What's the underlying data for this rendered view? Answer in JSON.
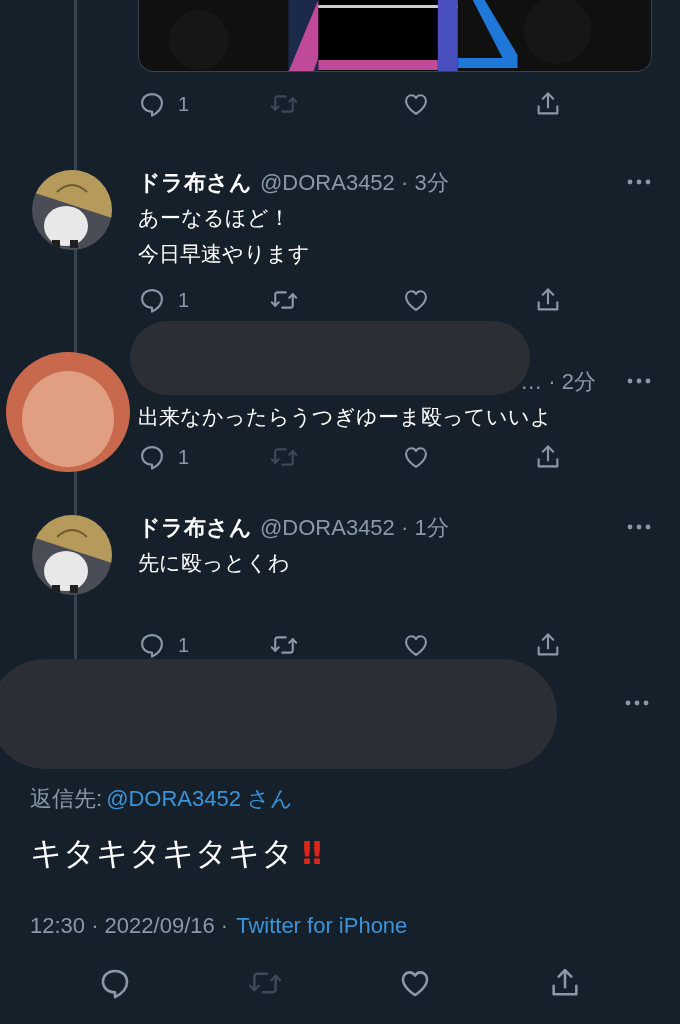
{
  "image_tweet": {
    "reply_count": "1",
    "retweet_disabled": true
  },
  "replies": [
    {
      "kind": "normal",
      "avatar": {
        "kind": "illustration"
      },
      "name": "ドラ布さん",
      "meta": "@DORA3452 · 3分",
      "lines": [
        "あーなるほど！",
        "今日早速やります"
      ],
      "reply_count": "1",
      "retweet_disabled": false
    },
    {
      "kind": "redacted",
      "avatar": {
        "kind": "monkey"
      },
      "meta": "… · 2分",
      "lines": [
        "出来なかったらうつぎゆーま殴っていいよ"
      ],
      "reply_count": "1",
      "retweet_disabled": true
    },
    {
      "kind": "normal",
      "avatar": {
        "kind": "illustration"
      },
      "name": "ドラ布さん",
      "meta": "@DORA3452 · 1分",
      "lines": [
        "先に殴っとくわ"
      ],
      "reply_count": "1",
      "retweet_disabled": false
    }
  ],
  "main_tweet": {
    "redacted": true,
    "reply_to_label": "返信先:",
    "reply_to": "@DORA3452 さん",
    "text": "キタキタキタキタ",
    "emphasis": "‼",
    "timestamp": "12:30 · 2022/09/16 ·",
    "source": "Twitter for iPhone",
    "retweet_disabled": true
  }
}
